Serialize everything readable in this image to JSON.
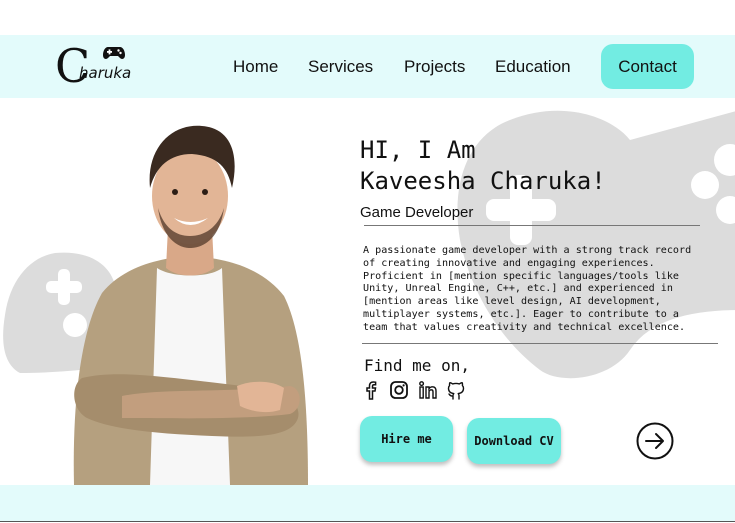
{
  "logo": {
    "initial": "C",
    "text": "haruka",
    "icon": "gamepad-icon"
  },
  "nav": {
    "home": "Home",
    "services": "Services",
    "projects": "Projects",
    "education": "Education",
    "contact": "Contact"
  },
  "hero": {
    "greeting_line1": "HI, I Am",
    "greeting_line2": "Kaveesha Charuka!",
    "role": "Game Developer",
    "about": "A passionate game developer with a strong track record of creating innovative and engaging experiences. Proficient in [mention specific languages/tools like Unity, Unreal Engine, C++, etc.] and experienced in [mention areas like level design, AI development, multiplayer systems, etc.]. Eager to contribute to a team that values creativity and technical excellence.",
    "find_label": "Find me on,",
    "socials": [
      "facebook-icon",
      "instagram-icon",
      "linkedin-icon",
      "github-icon"
    ],
    "hire_button": "Hire me",
    "cv_button": "Download CV",
    "next_icon": "arrow-right-icon"
  },
  "colors": {
    "accent": "#72ece2",
    "band": "#e3fbfb",
    "watermark": "#d9d9d9"
  }
}
